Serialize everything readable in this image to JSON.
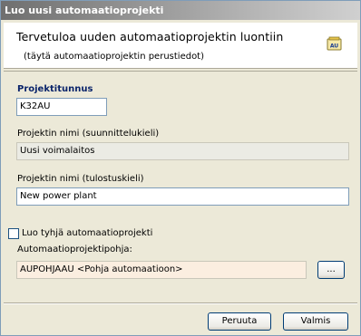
{
  "window": {
    "title": "Luo uusi automaatioprojekti"
  },
  "header": {
    "title": "Tervetuloa uuden automaatioprojektin luontiin",
    "subtitle": "(täytä automaatioprojektin perustiedot)",
    "icon": "project-wizard-icon",
    "icon_text": "AU"
  },
  "form": {
    "project_id_label": "Projektitunnus",
    "project_id_value": "K32AU",
    "name_design_label": "Projektin nimi (suunnittelukieli)",
    "name_design_value": "Uusi voimalaitos",
    "name_print_label": "Projektin nimi (tulostuskieli)",
    "name_print_value": "New power plant",
    "empty_checkbox_label": "Luo tyhjä automaatioprojekti",
    "empty_checkbox_checked": false,
    "template_label": "Automaatioprojektipohja:",
    "template_value": "AUPOHJAAU <Pohja automaatioon>",
    "browse_label": "..."
  },
  "footer": {
    "cancel_label": "Peruuta",
    "finish_label": "Valmis"
  }
}
